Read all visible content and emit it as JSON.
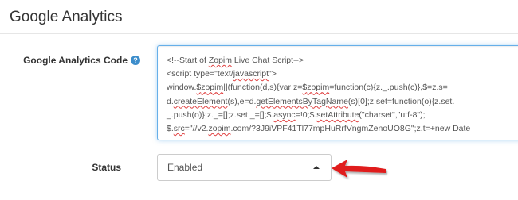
{
  "section": {
    "title": "Google Analytics"
  },
  "fields": {
    "code": {
      "label": "Google Analytics Code",
      "help_icon": "question-icon",
      "lines": [
        "<!--Start of Zopim Live Chat Script-->",
        "<script type=\"text/javascript\">",
        "window.$zopim||(function(d,s){var z=$zopim=function(c){z._.push(c)},$=z.s=",
        "d.createElement(s),e=d.getElementsByTagName(s)[0];z.set=function(o){z.set.",
        "_.push(o)};z._=[];z.set._=[];$.async=!0;$.setAttribute(\"charset\",\"utf-8\");",
        "$.src=\"//v2.zopim.com/?3J9iVPF41Tl77mpHuRrfVngmZenoUO8G\";z.t=+new Date"
      ]
    },
    "status": {
      "label": "Status",
      "selected": "Enabled"
    }
  },
  "colors": {
    "focus_border": "#66afe9",
    "help_icon": "#3c8dcb",
    "annotation_arrow": "#e01b1b"
  },
  "annotation": {
    "icon": "red-arrow-icon"
  }
}
